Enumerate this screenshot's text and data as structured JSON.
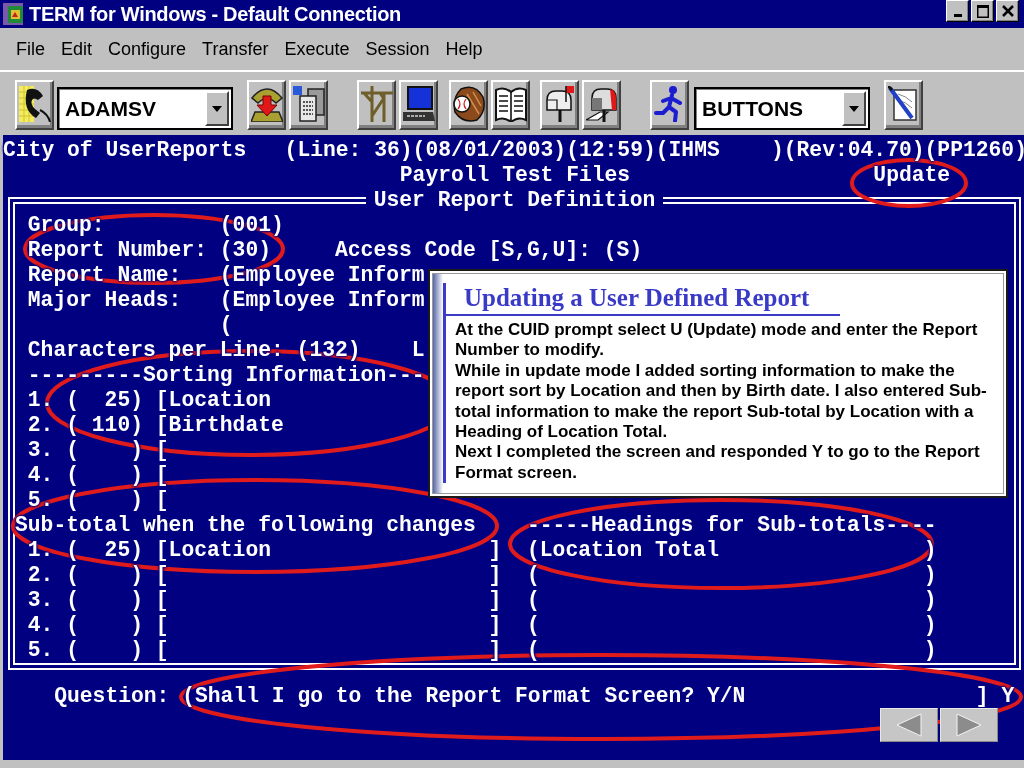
{
  "window": {
    "title": "TERM for Windows - Default Connection"
  },
  "menu": [
    {
      "label": "File"
    },
    {
      "label": "Edit"
    },
    {
      "label": "Configure"
    },
    {
      "label": "Transfer"
    },
    {
      "label": "Execute"
    },
    {
      "label": "Session"
    },
    {
      "label": "Help"
    }
  ],
  "toolbar": {
    "combos": [
      {
        "value": "ADAMSV"
      },
      {
        "value": "BUTTONS"
      }
    ]
  },
  "terminal": {
    "header_lines": [
      [
        "City of UserReports",
        "   (Line: 36)(08/01/2003)(12:59)(IHMS    )(Rev:04.70)(PP1260)"
      ],
      [
        "                               Payroll Test Files",
        "                   Update"
      ]
    ],
    "form": {
      "title": "User Report Definition",
      "lines": [
        [
          " Group:",
          "         (001)"
        ],
        [
          " Report Number: (30)",
          "     Access Code [S,G,U]: (S)"
        ],
        [
          " Report Name:",
          "   (Employee Inform"
        ],
        [
          " Major Heads:",
          "   (Employee Inform"
        ],
        [
          "                ("
        ],
        [
          " Characters per Line: (132)",
          "    L"
        ],
        [
          " ---------Sorting Information---"
        ],
        [
          " 1. (  25) [Location"
        ],
        [
          " 2. ( 110) [Birthdate"
        ],
        [
          " 3. (    ) ["
        ],
        [
          " 4. (    ) ["
        ],
        [
          " 5. (    ) ["
        ],
        [
          "Sub-total when the following changes",
          "    -----Headings for Sub-totals----"
        ],
        [
          " 1. (  25) [Location                 ]",
          "  (Location Total                )"
        ],
        [
          " 2. (    ) [                         ]",
          "  (                              )"
        ],
        [
          " 3. (    ) [                         ]",
          "  (                              )"
        ],
        [
          " 4. (    ) [                         ]",
          "  (                              )"
        ],
        [
          " 5. (    ) [                         ]",
          "  (                              )"
        ]
      ]
    },
    "question_line": [
      "    Question:",
      " (Shall I go to the Report Format Screen? Y/N                  ]",
      " Y"
    ]
  },
  "callout": {
    "title": "Updating a User Defined Report",
    "paragraphs": [
      "At the CUID prompt select U (Update) mode and enter the Report Number to modify.",
      "While in update mode I added sorting information to make the report sort by Location and then by Birth date. I also entered Sub-total information to make the report Sub-total by Location with a Heading of Location Total.",
      "Next I completed the screen and responded Y to go to the Report Format screen."
    ]
  }
}
